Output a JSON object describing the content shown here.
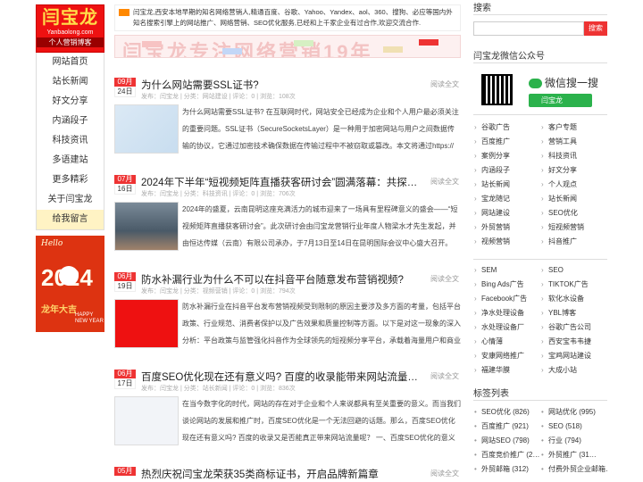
{
  "left": {
    "logo": {
      "main": "闫宝龙",
      "url": "Yanbaolong.com",
      "sub": "个人营销博客"
    },
    "nav": [
      "网站首页",
      "站长新闻",
      "好文分享",
      "内涵段子",
      "科技资讯",
      "多语建站",
      "更多精彩",
      "关于闫宝龙",
      "给我留言"
    ],
    "promo": {
      "hello": "Hello",
      "year": "2024",
      "greet": "龙年大吉",
      "hny": "HAPPY NEW YEAR"
    }
  },
  "intro": "闫宝龙,西安本地早期的知名网络营销人,精通百度、谷歌、Yahoo、Yandex、aol、360、搜狗、必应等国内外知名搜索引擎上的网站推广、网络营销、SEO优化服务,已经和上千家企业有过合作,欢迎交流合作.",
  "banner_text": "闫宝龙专注网络营销19年",
  "articles": [
    {
      "month": "09月",
      "day": "24日",
      "title": "为什么网站需要SSL证书?",
      "read": "阅读全文",
      "meta": "发布：闫宝龙 | 分类：网站建设 | 评论：0 | 浏览：108次",
      "body": "为什么网站需要SSL证书? 在互联网时代，网站安全已经成为企业和个人用户最必须关注的重要问题。SSL证书（SecureSocketsLayer）是一种用于加密网站与用户之间数据传输的协议，它通过加密技术确保数据在传输过程中不被窃取或篡改。本文将通过https://"
    },
    {
      "month": "07月",
      "day": "16日",
      "title": "2024年下半年“短视频矩阵直播获客研讨会”圆满落幕：共探互联网…",
      "read": "阅读全文",
      "meta": "发布：闫宝龙 | 分类：科技资讯 | 评论：0 | 浏览：706次",
      "body": "2024年的盛夏，云南昆明这座充满活力的城市迎来了一场具有里程碑意义的盛会——“短视频矩阵直播获客研讨会”。此次研讨会由闫宝龙营销行业年度人物梁水才先生发起，并由恒达传媒（云南）有限公司承办，于7月13日至14日在昆明国际会议中心盛大召开。"
    },
    {
      "month": "06月",
      "day": "19日",
      "title": "防水补漏行业为什么不可以在抖音平台随意发布营销视频?",
      "read": "阅读全文",
      "meta": "发布：闫宝龙 | 分类：视频营销 | 评论：0 | 浏览：794次",
      "body": "防水补漏行业在抖音平台发布营销视频受到限制的原因主要涉及多方面的考量，包括平台政策、行业规范、消费者保护以及广告效果和质量控制等方面。以下是对这一现象的深入分析：平台政策与监管强化抖音作为全球领先的短视频分享平台，承载着海量用户和商业"
    },
    {
      "month": "06月",
      "day": "17日",
      "title": "百度SEO优化现在还有意义吗? 百度的收录能带来网站流量吗?",
      "read": "阅读全文",
      "meta": "发布：闫宝龙 | 分类：站长新闻 | 评论：0 | 浏览：836次",
      "body": "在当今数字化的时代，网站的存在对于企业和个人来说都具有至关重要的意义。而当我们谈论网站的发展和推广时，百度SEO优化是一个无法回避的话题。那么，百度SEO优化现在还有意义吗? 百度的收录又是否能真正带来网站流量呢？  一、百度SEO优化的意义"
    },
    {
      "month": "05月",
      "day": "",
      "title": "热烈庆祝闫宝龙荣获35类商标证书，开启品牌新篇章",
      "read": "阅读全文",
      "meta": "",
      "body": ""
    }
  ],
  "right": {
    "search_title": "搜索",
    "search_placeholder": "",
    "search_btn": "搜索",
    "wx_title": "闫宝龙微信公众号",
    "wx_search": "微信搜一搜",
    "wx_btn": "闫宝龙",
    "cats1": [
      "谷歌广告",
      "客户专题",
      "百度推广",
      "营销工具",
      "案例分享",
      "科技资讯",
      "内涵段子",
      "好文分享",
      "站长新闻",
      "个人观点",
      "宝龙随记",
      "站长新闻",
      "网站建设",
      "SEO优化",
      "外贸营销",
      "短视频营销",
      "视频营销",
      "抖音推广"
    ],
    "cats2": [
      "SEM",
      "SEO",
      "Bing Ads广告",
      "TIKTOK广告",
      "Facebook广告",
      "软化水设备",
      "净水处理设备",
      "YBL博客",
      "水处理设备厂",
      "谷歌广告公司",
      "心情薄",
      "西安宝韦韦捷",
      "安康网络推广",
      "宝鸡网站建设",
      "福建华膜",
      "大成小站"
    ],
    "tags_title": "标签列表",
    "tags": [
      "SEO优化 (826)",
      "网站优化 (995)",
      "百度推广 (921)",
      "SEO (518)",
      "网站SEO (798)",
      "行业 (794)",
      "百度竞价推广 (2…",
      "外贸推广 (31…",
      "外贸邮箱 (312)",
      "付费外贸企业邮箱…"
    ]
  }
}
